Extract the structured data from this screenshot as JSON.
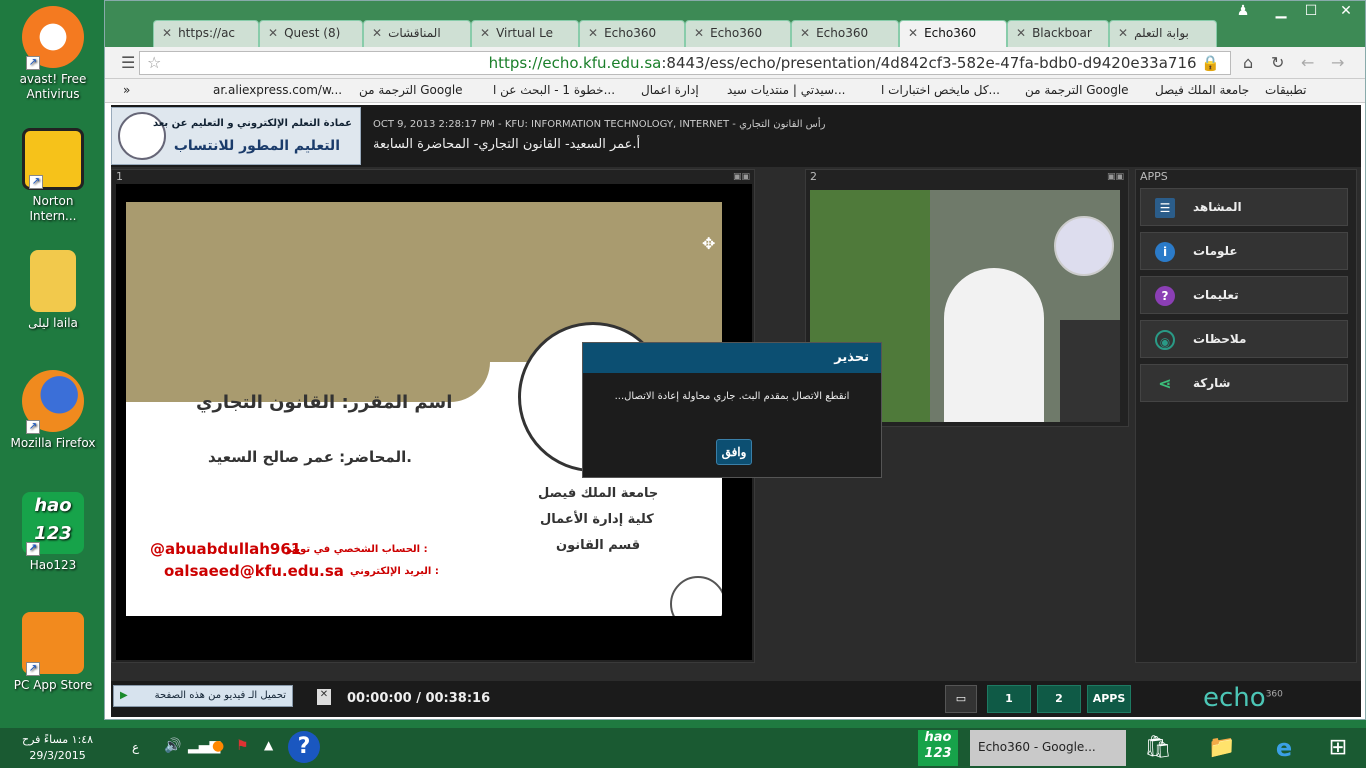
{
  "desktop": {
    "icons": [
      {
        "label": "avast! Free Antivirus"
      },
      {
        "label": "Norton Intern..."
      },
      {
        "label": "ليلى laila"
      },
      {
        "label": "Mozilla Firefox"
      },
      {
        "label": "Hao123"
      },
      {
        "label": "PC App Store"
      }
    ]
  },
  "browser": {
    "tabs": [
      {
        "label": "بوابة التعلم"
      },
      {
        "label": "Blackboar"
      },
      {
        "label": "Echo360"
      },
      {
        "label": "Echo360"
      },
      {
        "label": "Echo360"
      },
      {
        "label": "Echo360"
      },
      {
        "label": "Virtual Le"
      },
      {
        "label": "المناقشات"
      },
      {
        "label": "Quest (8)"
      },
      {
        "label": "https://ac"
      }
    ],
    "url_host": "https://echo.kfu.edu.sa",
    "url_path": ":8443/ess/echo/presentation/4d842cf3-582e-47fa-bdb0-d9420e33a716",
    "bookmarks": [
      {
        "label": "تطبيقات"
      },
      {
        "label": "جامعة الملك فيصل"
      },
      {
        "label": "الترجمة من Google"
      },
      {
        "label": "كل مايخص اختبارات ا..."
      },
      {
        "label": "سيدتي | منتديات سيد..."
      },
      {
        "label": "إدارة اعمال"
      },
      {
        "label": "خطوة 1 - البحث عن ا..."
      },
      {
        "label": "الترجمة من Google"
      },
      {
        "label": "ar.aliexpress.com/w..."
      },
      {
        "label": "»"
      }
    ]
  },
  "echo": {
    "logo_line1": "عمادة التعلم الإلكتروني و التعليم عن بعد",
    "logo_line2": "التعليم المطور للانتساب",
    "meta": "OCT 9, 2013 2:28:17 PM - KFU: INFORMATION TECHNOLOGY, INTERNET - رأس القانون التجاري",
    "course_title": "أ.عمر السعيد- القانون التجاري- المحاضرة السابعة",
    "panel1_num": "1",
    "panel2_num": "2",
    "apps_title": "APPS",
    "apps": [
      {
        "label": "المشاهد",
        "icon": "views-icon"
      },
      {
        "label": "علومات",
        "icon": "info-icon"
      },
      {
        "label": "تعليمات",
        "icon": "help-icon"
      },
      {
        "label": "ملاحظات",
        "icon": "notes-icon"
      },
      {
        "label": "شاركة",
        "icon": "share-icon"
      }
    ],
    "slide": {
      "course_name": "اسم المقرر: القانون التجاري",
      "lecturer": "المحاضر: عمر صالح السعيد.",
      "twitter_label": "الحساب الشخصي في تويتر :",
      "twitter": "@abuabdullah961",
      "email_label": "البريد الإلكتروني :",
      "email": "oalsaeed@kfu.edu.sa",
      "uni": "جامعة الملك فيصل",
      "college": "كلية إدارة الأعمال",
      "dept": "قسم القانون"
    },
    "dialog": {
      "title": "تحذير",
      "message": "...انقطع الاتصال بمقدم البث. جاري محاولة إعادة الاتصال",
      "ok": "وافق"
    },
    "time": "00:00:00 / 00:38:16",
    "download_bar": "تحميل الـ فيديو من هذه الصفحة",
    "btn1": "1",
    "btn2": "2",
    "btn_apps": "APPS",
    "brand": "echo",
    "brand_sup": "360"
  },
  "taskbar": {
    "time": "١:٤٨ مساءً  فرح",
    "date": "29/3/2015",
    "lang": "ع",
    "chrome_task": "Echo360 - Google..."
  }
}
